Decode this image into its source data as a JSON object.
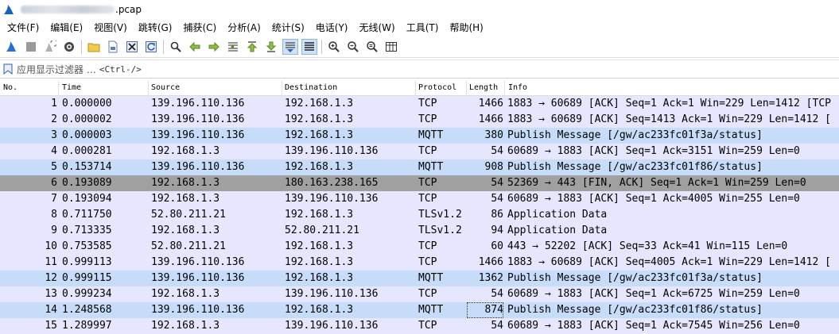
{
  "window": {
    "title_suffix": ".pcap"
  },
  "menu": [
    "文件(F)",
    "编辑(E)",
    "视图(V)",
    "跳转(G)",
    "捕获(C)",
    "分析(A)",
    "统计(S)",
    "电话(Y)",
    "无线(W)",
    "工具(T)",
    "帮助(H)"
  ],
  "filter": {
    "label": "应用显示过滤器 …",
    "placeholder": "<Ctrl-/>"
  },
  "columns": {
    "no": "No.",
    "time": "Time",
    "source": "Source",
    "destination": "Destination",
    "protocol": "Protocol",
    "length": "Length",
    "info": "Info"
  },
  "colors": {
    "tcp_row": "#e7e6ff",
    "mqtt_row": "#c7dcf8",
    "fin_row": "#a0a0a0"
  },
  "packets": [
    {
      "no": "1",
      "time": "0.000000",
      "source": "139.196.110.136",
      "destination": "192.168.1.3",
      "protocol": "TCP",
      "length": "1466",
      "info": "1883 → 60689 [ACK] Seq=1 Ack=1 Win=229 Len=1412 [TCP"
    },
    {
      "no": "2",
      "time": "0.000002",
      "source": "139.196.110.136",
      "destination": "192.168.1.3",
      "protocol": "TCP",
      "length": "1466",
      "info": "1883 → 60689 [ACK] Seq=1413 Ack=1 Win=229 Len=1412 ["
    },
    {
      "no": "3",
      "time": "0.000003",
      "source": "139.196.110.136",
      "destination": "192.168.1.3",
      "protocol": "MQTT",
      "length": "380",
      "info": "Publish Message [/gw/ac233fc01f3a/status]"
    },
    {
      "no": "4",
      "time": "0.000281",
      "source": "192.168.1.3",
      "destination": "139.196.110.136",
      "protocol": "TCP",
      "length": "54",
      "info": "60689 → 1883 [ACK] Seq=1 Ack=3151 Win=259 Len=0"
    },
    {
      "no": "5",
      "time": "0.153714",
      "source": "139.196.110.136",
      "destination": "192.168.1.3",
      "protocol": "MQTT",
      "length": "908",
      "info": "Publish Message [/gw/ac233fc01f86/status]"
    },
    {
      "no": "6",
      "time": "0.193089",
      "source": "192.168.1.3",
      "destination": "180.163.238.165",
      "protocol": "TCP",
      "length": "54",
      "info": "52369 → 443 [FIN, ACK] Seq=1 Ack=1 Win=259 Len=0"
    },
    {
      "no": "7",
      "time": "0.193094",
      "source": "192.168.1.3",
      "destination": "139.196.110.136",
      "protocol": "TCP",
      "length": "54",
      "info": "60689 → 1883 [ACK] Seq=1 Ack=4005 Win=255 Len=0"
    },
    {
      "no": "8",
      "time": "0.711750",
      "source": "52.80.211.21",
      "destination": "192.168.1.3",
      "protocol": "TLSv1.2",
      "length": "86",
      "info": "Application Data"
    },
    {
      "no": "9",
      "time": "0.713335",
      "source": "192.168.1.3",
      "destination": "52.80.211.21",
      "protocol": "TLSv1.2",
      "length": "94",
      "info": "Application Data"
    },
    {
      "no": "10",
      "time": "0.753585",
      "source": "52.80.211.21",
      "destination": "192.168.1.3",
      "protocol": "TCP",
      "length": "60",
      "info": "443 → 52202 [ACK] Seq=33 Ack=41 Win=115 Len=0"
    },
    {
      "no": "11",
      "time": "0.999113",
      "source": "139.196.110.136",
      "destination": "192.168.1.3",
      "protocol": "TCP",
      "length": "1466",
      "info": "1883 → 60689 [ACK] Seq=4005 Ack=1 Win=229 Len=1412 ["
    },
    {
      "no": "12",
      "time": "0.999115",
      "source": "139.196.110.136",
      "destination": "192.168.1.3",
      "protocol": "MQTT",
      "length": "1362",
      "info": "Publish Message [/gw/ac233fc01f3a/status]"
    },
    {
      "no": "13",
      "time": "0.999234",
      "source": "192.168.1.3",
      "destination": "139.196.110.136",
      "protocol": "TCP",
      "length": "54",
      "info": "60689 → 1883 [ACK] Seq=1 Ack=6725 Win=259 Len=0"
    },
    {
      "no": "14",
      "time": "1.248568",
      "source": "139.196.110.136",
      "destination": "192.168.1.3",
      "protocol": "MQTT",
      "length": "874",
      "info": "Publish Message [/gw/ac233fc01f86/status]"
    },
    {
      "no": "15",
      "time": "1.289997",
      "source": "192.168.1.3",
      "destination": "139.196.110.136",
      "protocol": "TCP",
      "length": "54",
      "info": "60689 → 1883 [ACK] Seq=1 Ack=7545 Win=256 Len=0"
    }
  ]
}
